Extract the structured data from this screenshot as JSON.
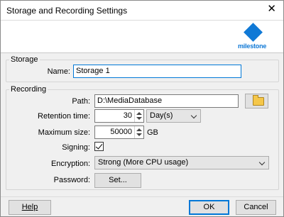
{
  "window": {
    "title": "Storage and Recording Settings",
    "close_glyph": "✕"
  },
  "brand": {
    "name": "milestone",
    "color": "#1079d6",
    "icon": "milestone-diamond-logo"
  },
  "storage": {
    "legend": "Storage",
    "name_label": "Name:",
    "name_value": "Storage 1"
  },
  "recording": {
    "legend": "Recording",
    "path_label": "Path:",
    "path_value": "D:\\MediaDatabase",
    "browse_icon": "folder-icon",
    "retention_label": "Retention time:",
    "retention_value": "30",
    "retention_unit": "Day(s)",
    "max_size_label": "Maximum size:",
    "max_size_value": "50000",
    "max_size_unit": "GB",
    "signing_label": "Signing:",
    "signing_checked": true,
    "encryption_label": "Encryption:",
    "encryption_value": "Strong (More CPU usage)",
    "password_label": "Password:",
    "password_button": "Set..."
  },
  "footer": {
    "help": "Help",
    "ok": "OK",
    "cancel": "Cancel"
  }
}
